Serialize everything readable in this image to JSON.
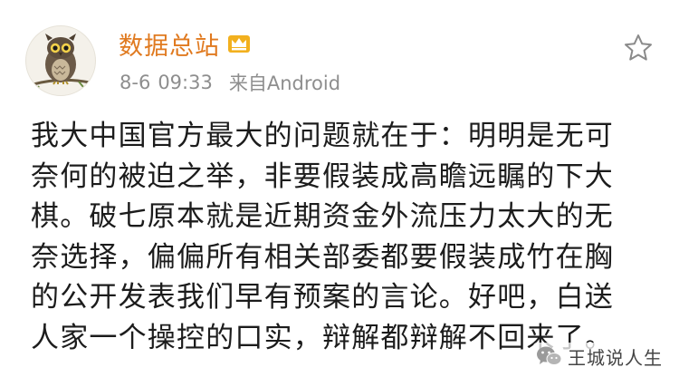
{
  "post": {
    "author": "数据总站",
    "date": "8-6",
    "time": "09:33",
    "source": "来自Android",
    "lines": [
      "我大中国官方最大的问题就在于：明明是无可",
      "奈何的被迫之举，非要假装成高瞻远瞩的下大",
      "棋。破七原本就是近期资金外流压力太大的无",
      "奈选择，偏偏所有相关部委都要假装成竹在胸",
      "的公开发表我们早有预案的言论。好吧，白送",
      "人家一个操控的口实，辩解都辩解不回来了。"
    ]
  },
  "icons": {
    "avatar": "owl-avatar",
    "badge": "vip-crown-icon",
    "favorite": "star-icon",
    "watermark_logo": "wechat-icon"
  },
  "watermark": {
    "text": "王城说人生"
  },
  "colors": {
    "author": "#e07a20",
    "meta": "#8e8e8e",
    "text": "#1c1c1c",
    "badge": "#f2b01e"
  }
}
